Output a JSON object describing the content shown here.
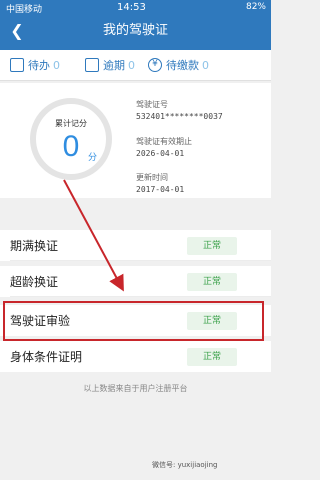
{
  "status_bar": {
    "carrier": "中国移动",
    "time": "14:53",
    "battery": "82%"
  },
  "header": {
    "title": "我的驾驶证",
    "back_icon": "chevron-left-icon"
  },
  "tabs": [
    {
      "label": "待办",
      "count": "0",
      "icon": "checklist-icon"
    },
    {
      "label": "逾期",
      "count": "0",
      "icon": "warning-icon"
    },
    {
      "label": "待缴款",
      "count": "0",
      "icon": "yen-icon"
    }
  ],
  "summary": {
    "score_label": "累计记分",
    "score": "0",
    "score_unit": "分",
    "license_no_label": "驾驶证号",
    "license_no": "532401********0037",
    "expiry_label": "驾驶证有效期止",
    "expiry": "2026-04-01",
    "updated_label": "更新时间",
    "updated": "2017-04-01"
  },
  "items": [
    {
      "name": "期满换证",
      "status": "正常"
    },
    {
      "name": "超龄换证",
      "status": "正常"
    },
    {
      "name": "驾驶证审验",
      "status": "正常"
    },
    {
      "name": "身体条件证明",
      "status": "正常"
    }
  ],
  "note": "以上数据来自于用户注册平台",
  "watermark": "微信号: yuxijiaojing",
  "colors": {
    "header": "#2f79bd",
    "accent": "#2f8de0",
    "ok_text": "#3aa14a",
    "ok_bg": "#e9f4ea",
    "highlight": "#c8262b"
  }
}
